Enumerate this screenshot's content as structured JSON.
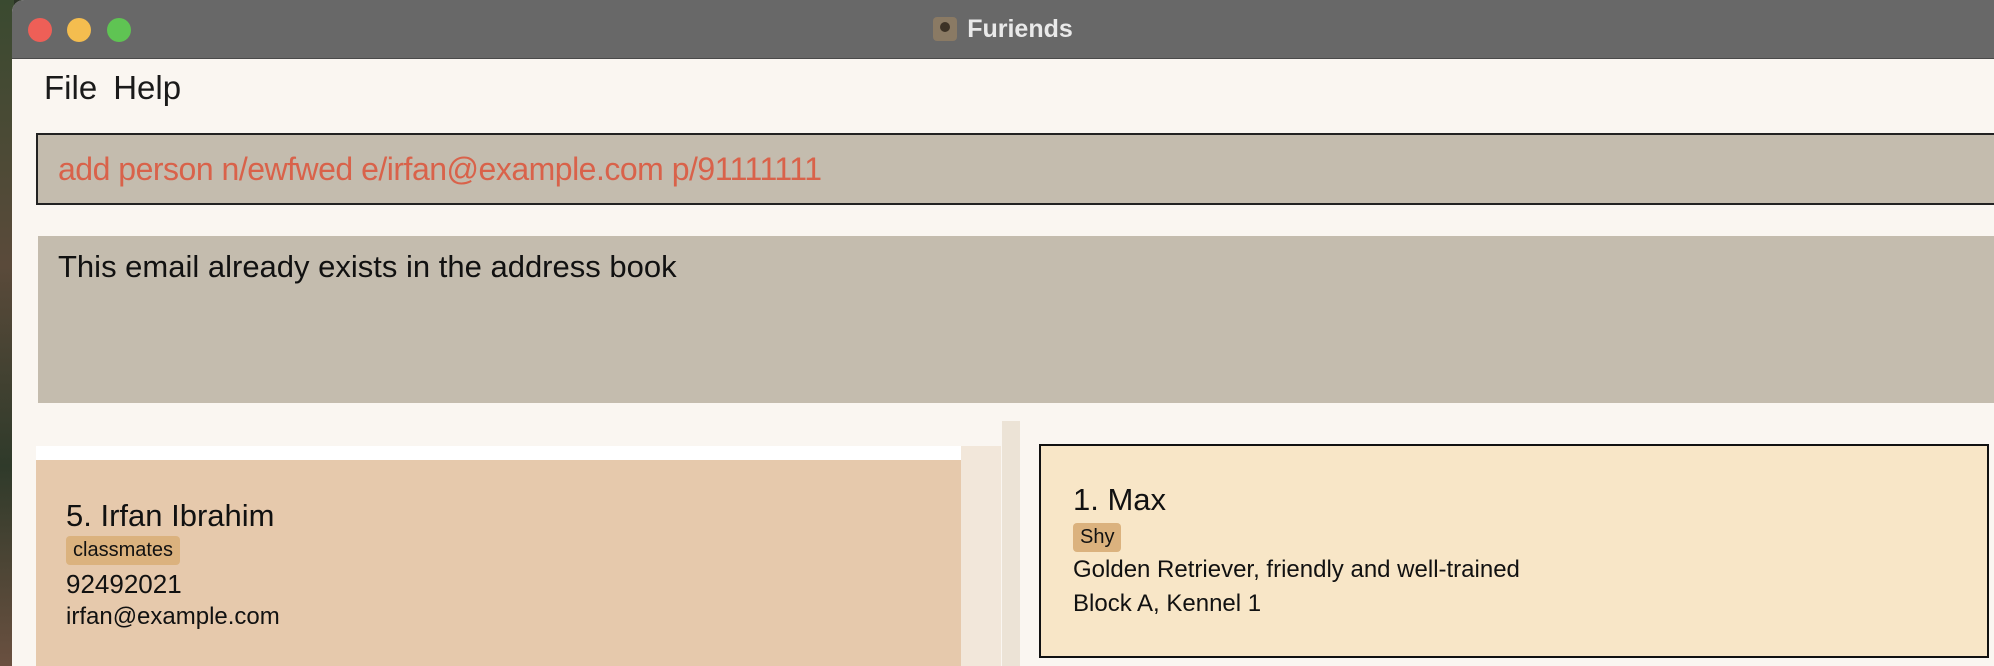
{
  "window": {
    "title": "Furiends"
  },
  "menu": {
    "file": "File",
    "help": "Help"
  },
  "command": {
    "value": "add person n/ewfwed e/irfan@example.com p/91111111"
  },
  "result": {
    "message": "This email already exists in the address book"
  },
  "person": {
    "name": "5. Irfan Ibrahim",
    "tag": "classmates",
    "phone": "92492021",
    "email": "irfan@example.com"
  },
  "pet": {
    "name": "1. Max",
    "tag": "Shy",
    "description": "Golden Retriever, friendly and well-trained",
    "location": "Block A, Kennel 1"
  },
  "colors": {
    "command_text": "#d9624a",
    "person_card_bg": "#e6c9ac",
    "pet_card_bg": "#f8e6c7",
    "tag_bg": "#dbb27e"
  }
}
